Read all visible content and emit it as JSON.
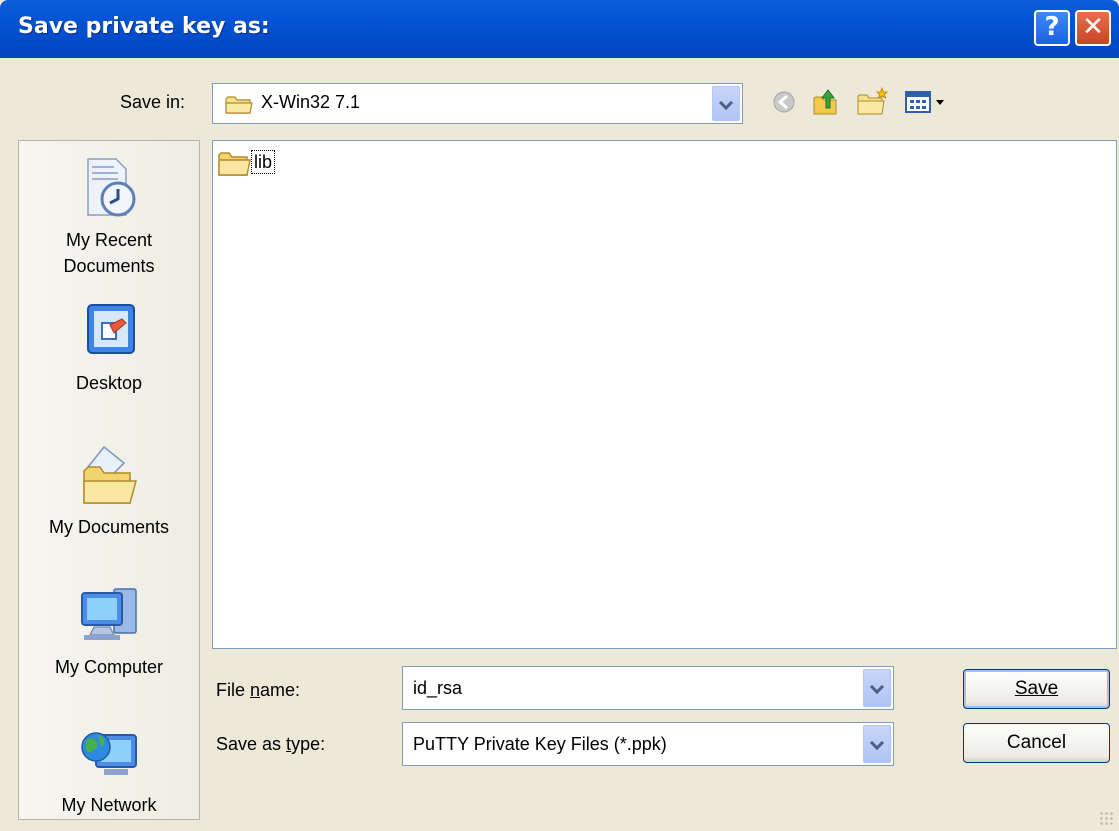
{
  "window": {
    "title": "Save private key as:",
    "help_glyph": "?",
    "close_glyph": "✕"
  },
  "save_in": {
    "label": "Save in:",
    "value": "X-Win32 7.1"
  },
  "toolbar": {
    "icons": [
      "back-icon",
      "up-folder-icon",
      "new-folder-icon",
      "view-menu-icon"
    ]
  },
  "places": [
    {
      "label": "My Recent\nDocuments",
      "icon": "recent-documents-icon"
    },
    {
      "label": "Desktop",
      "icon": "desktop-icon"
    },
    {
      "label": "My Documents",
      "icon": "my-documents-icon"
    },
    {
      "label": "My Computer",
      "icon": "my-computer-icon"
    },
    {
      "label": "My Network",
      "icon": "my-network-icon"
    }
  ],
  "files": [
    {
      "name": "lib",
      "type": "folder"
    }
  ],
  "file_name": {
    "label": "File name:",
    "value": "id_rsa"
  },
  "file_type": {
    "label": "Save as type:",
    "value": "PuTTY Private Key Files (*.ppk)"
  },
  "buttons": {
    "save": "Save",
    "cancel": "Cancel"
  },
  "colors": {
    "titlebar": "#0553D5",
    "dialog_bg": "#ECE9D8",
    "close_button": "#C84324",
    "border": "#7F9DB9"
  }
}
